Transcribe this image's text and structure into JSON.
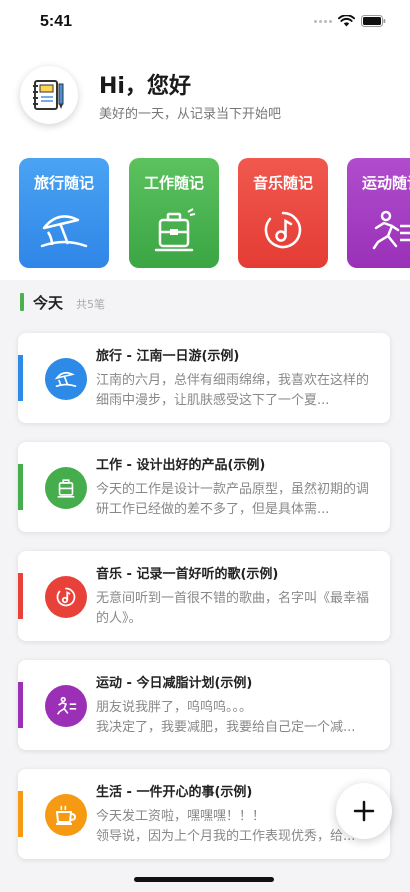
{
  "status_bar": {
    "time": "5:41"
  },
  "header": {
    "greeting": "Hi，您好",
    "subtitle": "美好的一天，从记录当下开始吧",
    "avatar_icon": "notebook-icon"
  },
  "categories": [
    {
      "label": "旅行随记",
      "icon": "beach-umbrella-icon",
      "color": "#3a93ed"
    },
    {
      "label": "工作随记",
      "icon": "briefcase-icon",
      "color": "#4cb552"
    },
    {
      "label": "音乐随记",
      "icon": "music-note-icon",
      "color": "#ea4a40"
    },
    {
      "label": "运动随记",
      "icon": "running-icon",
      "color": "#a63fc3"
    }
  ],
  "section": {
    "title": "今天",
    "count": "共5笔"
  },
  "entries": [
    {
      "title": "旅行 - 江南一日游(示例)",
      "body": "江南的六月，总伴有细雨绵绵，我喜欢在这样的细雨中漫步，让肌肤感受这下了一个夏...",
      "color": "#2d8ae6",
      "icon": "beach-umbrella-icon"
    },
    {
      "title": "工作 - 设计出好的产品(示例)",
      "body": "今天的工作是设计一款产品原型，虽然初期的调研工作已经做的差不多了，但是具体需...",
      "color": "#45ad4c",
      "icon": "briefcase-icon"
    },
    {
      "title": "音乐 - 记录一首好听的歌(示例)",
      "body": "无意间听到一首很不错的歌曲，名字叫《最幸福的人》。",
      "color": "#e8413a",
      "icon": "music-note-icon"
    },
    {
      "title": "运动 - 今日减脂计划(示例)",
      "body": "朋友说我胖了，呜呜呜。。。\n我决定了，我要减肥，我要给自己定一个减...",
      "color": "#9b2fb6",
      "icon": "running-icon"
    },
    {
      "title": "生活 - 一件开心的事(示例)",
      "body": "今天发工资啦，嘿嘿嘿！！！\n领导说，因为上个月我的工作表现优秀，给...",
      "color": "#f59a12",
      "icon": "coffee-cup-icon"
    }
  ],
  "fab": {
    "icon": "plus-icon"
  }
}
